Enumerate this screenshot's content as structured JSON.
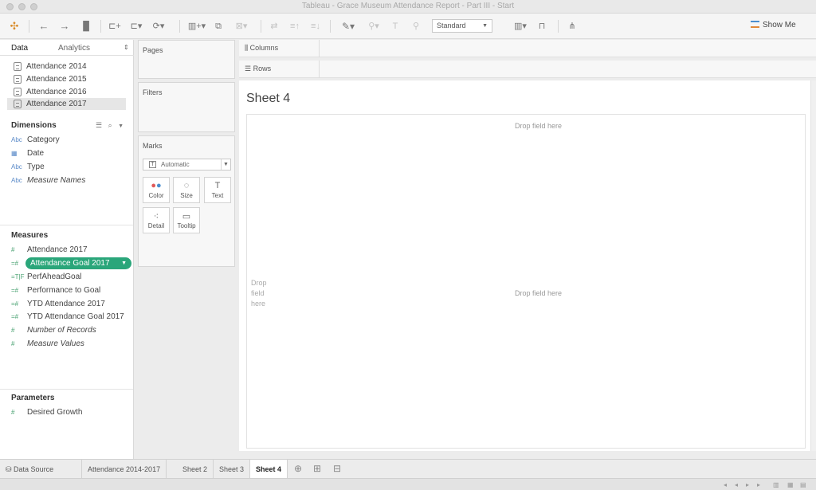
{
  "window": {
    "title": "Tableau - Grace Museum Attendance Report - Part III - Start"
  },
  "toolbar": {
    "fit_select": "Standard",
    "show_me": "Show Me"
  },
  "data_pane": {
    "tabs": [
      "Data",
      "Analytics"
    ],
    "data_sources": [
      {
        "label": "Attendance 2014",
        "selected": false
      },
      {
        "label": "Attendance 2015",
        "selected": false
      },
      {
        "label": "Attendance 2016",
        "selected": false
      },
      {
        "label": "Attendance 2017",
        "selected": true
      }
    ],
    "dimensions_label": "Dimensions",
    "dimensions": [
      {
        "icon": "Abc",
        "label": "Category",
        "italic": false
      },
      {
        "icon": "date",
        "label": "Date",
        "italic": false
      },
      {
        "icon": "Abc",
        "label": "Type",
        "italic": false
      },
      {
        "icon": "Abc",
        "label": "Measure Names",
        "italic": true
      }
    ],
    "measures_label": "Measures",
    "measures": [
      {
        "icon": "#",
        "label": "Attendance 2017",
        "italic": false
      },
      {
        "icon": "=#",
        "label": "Attendance Goal 2017",
        "italic": false,
        "pill": true
      },
      {
        "icon": "=T|F",
        "label": "PerfAheadGoal",
        "italic": false
      },
      {
        "icon": "=#",
        "label": "Performance to Goal",
        "italic": false
      },
      {
        "icon": "=#",
        "label": "YTD Attendance 2017",
        "italic": false
      },
      {
        "icon": "=#",
        "label": "YTD Attendance Goal 2017",
        "italic": false
      },
      {
        "icon": "#",
        "label": "Number of Records",
        "italic": true
      },
      {
        "icon": "#",
        "label": "Measure Values",
        "italic": true
      }
    ],
    "parameters_label": "Parameters",
    "parameters": [
      {
        "icon": "#",
        "label": "Desired Growth"
      }
    ]
  },
  "shelves": {
    "pages": "Pages",
    "filters": "Filters",
    "marks": "Marks",
    "marks_type": "Automatic",
    "mark_buttons": [
      "Color",
      "Size",
      "Text",
      "Detail",
      "Tooltip"
    ],
    "columns": "Columns",
    "rows": "Rows"
  },
  "canvas": {
    "sheet_title": "Sheet 4",
    "drop_top": "Drop field here",
    "drop_center": "Drop field here",
    "drop_rows": "Drop field here"
  },
  "sheet_tabs": {
    "data_source": "Data Source",
    "tabs": [
      {
        "label": "Attendance 2014-2017",
        "active": false
      },
      {
        "label": "Sheet 2",
        "active": false
      },
      {
        "label": "Sheet 3",
        "active": false
      },
      {
        "label": "Sheet 4",
        "active": true
      }
    ]
  },
  "colors": {
    "pill_green": "#2aa67a",
    "accent_blue": "#4a8fcf"
  }
}
